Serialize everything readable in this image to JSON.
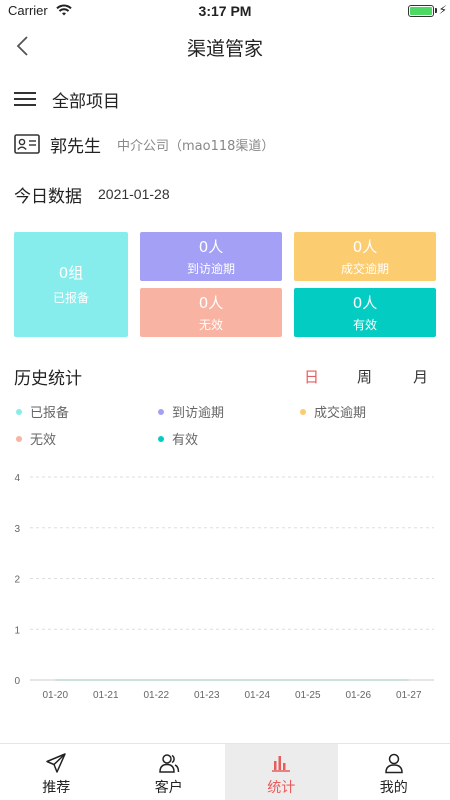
{
  "status_bar": {
    "carrier": "Carrier",
    "time": "3:17 PM"
  },
  "nav": {
    "title": "渠道管家"
  },
  "project": {
    "label": "全部项目"
  },
  "user": {
    "name": "郭先生",
    "company": "中介公司（mao118渠道）"
  },
  "today": {
    "label": "今日数据",
    "date": "2021-01-28"
  },
  "stats": {
    "reported": {
      "value": "0组",
      "label": "已报备",
      "color": "#87ecec"
    },
    "visit_overdue": {
      "value": "0人",
      "label": "到访逾期",
      "color": "#a3a0f6"
    },
    "deal_overdue": {
      "value": "0人",
      "label": "成交逾期",
      "color": "#fbcc70"
    },
    "invalid": {
      "value": "0人",
      "label": "无效",
      "color": "#f9b3a2"
    },
    "valid": {
      "value": "0人",
      "label": "有效",
      "color": "#03cdc3"
    }
  },
  "history": {
    "label": "历史统计",
    "periods": {
      "day": "日",
      "week": "周",
      "month": "月"
    },
    "active_period": "day",
    "legend": [
      {
        "name": "已报备",
        "color": "#87ecec"
      },
      {
        "name": "到访逾期",
        "color": "#a3a0f6"
      },
      {
        "name": "成交逾期",
        "color": "#fbcc70"
      },
      {
        "name": "无效",
        "color": "#f9b3a2"
      },
      {
        "name": "有效",
        "color": "#03cdc3"
      }
    ]
  },
  "chart_data": {
    "type": "line",
    "categories": [
      "01-20",
      "01-21",
      "01-22",
      "01-23",
      "01-24",
      "01-25",
      "01-26",
      "01-27"
    ],
    "y_ticks": [
      "0",
      "1",
      "2",
      "3",
      "4"
    ],
    "ylim": [
      0,
      4
    ],
    "grid": true,
    "series": [
      {
        "name": "已报备",
        "values": [
          0,
          0,
          0,
          0,
          0,
          0,
          0,
          0
        ]
      },
      {
        "name": "到访逾期",
        "values": [
          0,
          0,
          0,
          0,
          0,
          0,
          0,
          0
        ]
      },
      {
        "name": "成交逾期",
        "values": [
          0,
          0,
          0,
          0,
          0,
          0,
          0,
          0
        ]
      },
      {
        "name": "无效",
        "values": [
          0,
          0,
          0,
          0,
          0,
          0,
          0,
          0
        ]
      },
      {
        "name": "有效",
        "values": [
          0,
          0,
          0,
          0,
          0,
          0,
          0,
          0
        ]
      }
    ]
  },
  "tabs": [
    {
      "label": "推荐",
      "icon": "send-icon"
    },
    {
      "label": "客户",
      "icon": "customers-icon"
    },
    {
      "label": "统计",
      "icon": "bar-chart-icon"
    },
    {
      "label": "我的",
      "icon": "user-icon"
    }
  ]
}
